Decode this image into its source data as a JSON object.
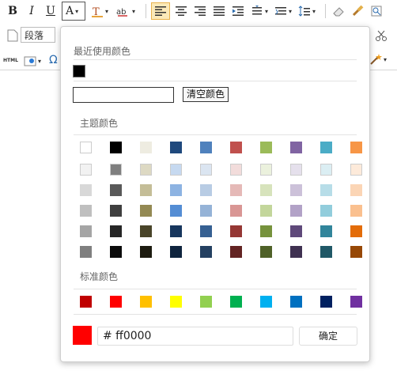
{
  "toolbar": {
    "row1": [
      {
        "name": "bold-button",
        "label": "B",
        "cls": "bold"
      },
      {
        "name": "italic-button",
        "label": "I",
        "cls": "italic"
      },
      {
        "name": "underline-button",
        "label": "U",
        "cls": "underline"
      }
    ],
    "forecolor_label": "A",
    "paragraph_label": "段落",
    "html_label": "HTML",
    "omega_label": "Ω"
  },
  "color_picker": {
    "recent_title": "最近使用颜色",
    "recent_colors": [
      "#000000"
    ],
    "clear_button": "清空颜色",
    "theme_title": "主题颜色",
    "theme_colors": [
      [
        "#ffffff",
        "#000000",
        "#eeece1",
        "#1f497d",
        "#4f81bd",
        "#c0504d",
        "#9bbb59",
        "#8064a2",
        "#4bacc6",
        "#f79646"
      ],
      [
        "#f2f2f2",
        "#7f7f7f",
        "#ddd9c3",
        "#c6d9f0",
        "#dbe5f1",
        "#f2dcdb",
        "#ebf1dd",
        "#e5e0ec",
        "#dbeef3",
        "#fdeada"
      ],
      [
        "#d8d8d8",
        "#595959",
        "#c4bd97",
        "#8db3e2",
        "#b8cce4",
        "#e5b9b7",
        "#d7e3bc",
        "#ccc1d9",
        "#b7dde8",
        "#fbd5b5"
      ],
      [
        "#bfbfbf",
        "#3f3f3f",
        "#938953",
        "#548dd4",
        "#95b3d7",
        "#d99694",
        "#c3d69b",
        "#b2a2c7",
        "#92cddc",
        "#fac08f"
      ],
      [
        "#a5a5a5",
        "#262626",
        "#494429",
        "#17365d",
        "#366092",
        "#953734",
        "#76923c",
        "#5f497a",
        "#31859b",
        "#e36c09"
      ],
      [
        "#7f7f7f",
        "#0c0c0c",
        "#1d1b10",
        "#0f243e",
        "#244061",
        "#632423",
        "#4f6128",
        "#3f3151",
        "#205867",
        "#974806"
      ]
    ],
    "standard_title": "标准颜色",
    "standard_colors": [
      "#c00000",
      "#ff0000",
      "#ffc000",
      "#ffff00",
      "#92d050",
      "#00b050",
      "#00b0f0",
      "#0070c0",
      "#002060",
      "#7030a0"
    ],
    "preview_color": "#ff0000",
    "hex_value": "# ff0000",
    "ok_button": "确定"
  }
}
